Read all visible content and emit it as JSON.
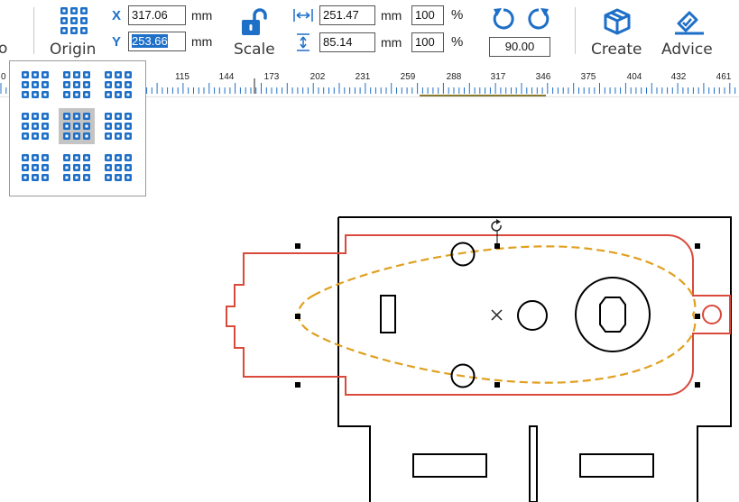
{
  "toolbar": {
    "origin_label": "Origin",
    "scale_label": "Scale",
    "create_label": "Create",
    "advice_label": "Advice",
    "left_cut_label": "o",
    "x_axis_label": "X",
    "y_axis_label": "Y",
    "x_value": "317.06",
    "y_value": "253.66",
    "unit_mm": "mm",
    "width_value": "251.47",
    "height_value": "85.14",
    "width_percent": "100",
    "height_percent": "100",
    "percent_sign": "%",
    "rotation_value": "90.00",
    "icons": {
      "origin": "grid-origin-icon",
      "scale": "unlock-icon",
      "width": "width-arrows-icon",
      "height": "height-arrows-icon",
      "rotate_ccw": "rotate-left-icon",
      "rotate_cw": "rotate-right-icon",
      "create": "box-icon",
      "advice": "check-pencil-icon"
    }
  },
  "ruler": {
    "labels": [
      "0",
      "115",
      "144",
      "173",
      "202",
      "231",
      "259",
      "288",
      "317",
      "346",
      "375",
      "404",
      "432",
      "461"
    ]
  },
  "origin_popup": {
    "cells": [
      "top-left",
      "top-center",
      "top-right",
      "middle-left",
      "center",
      "middle-right",
      "bottom-left",
      "bottom-center",
      "bottom-right"
    ],
    "selected": "center"
  },
  "colors": {
    "accent": "#1e6fc7",
    "part_outline": "#d94a3c",
    "dashed_path": "#e0a020",
    "selected_range": "#8a7a30",
    "black": "#000000"
  }
}
